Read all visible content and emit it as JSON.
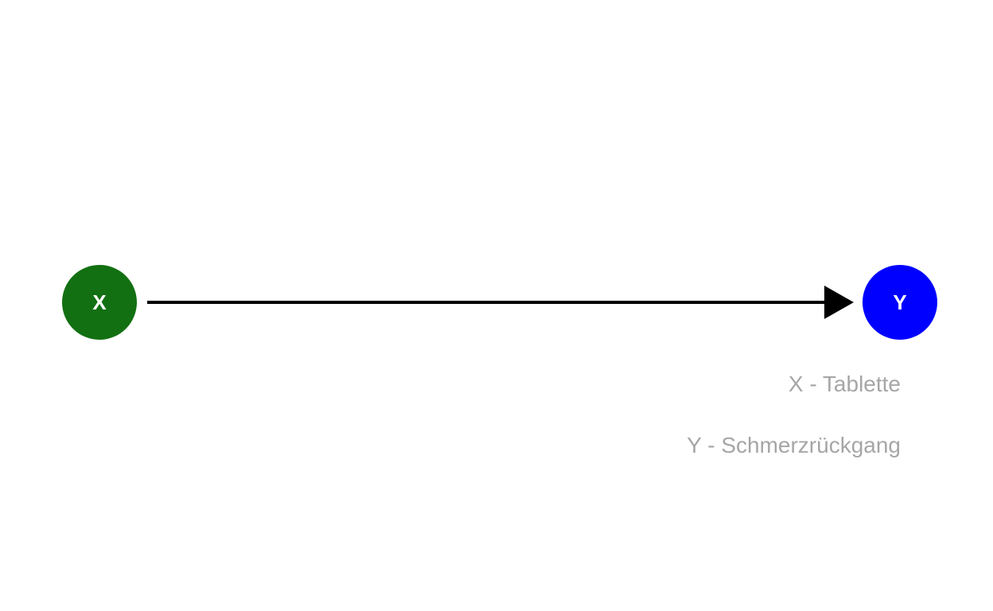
{
  "nodes": {
    "x": {
      "label": "X",
      "color": "#127012"
    },
    "y": {
      "label": "Y",
      "color": "#0000ff"
    }
  },
  "edge": {
    "from": "X",
    "to": "Y",
    "color": "#000000"
  },
  "legend": {
    "x_text": "X - Tablette",
    "y_text": "Y - Schmerzrückgang",
    "color": "#a6a6a6"
  }
}
